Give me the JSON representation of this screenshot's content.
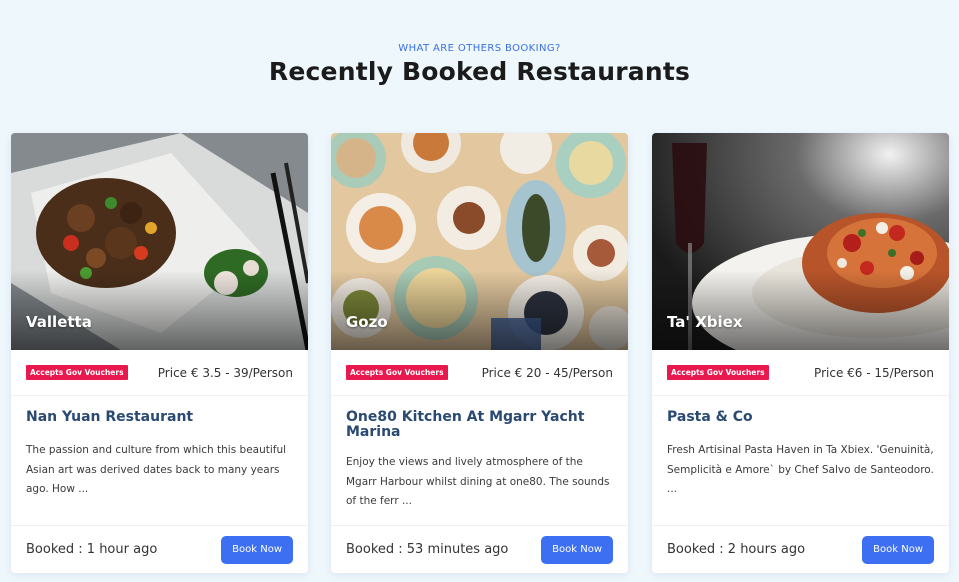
{
  "header": {
    "eyebrow": "WHAT ARE OTHERS BOOKING?",
    "title": "Recently Booked Restaurants"
  },
  "colors": {
    "accent": "#3d6ff2",
    "badge": "#e8194f",
    "restaurant_name": "#2a4a72",
    "background": "#eef7fc"
  },
  "cards": [
    {
      "city": "Valletta",
      "badge": "Accepts Gov Vouchers",
      "price": "Price € 3.5 - 39/Person",
      "name": "Nan Yuan Restaurant",
      "description": "The passion and culture from which this beautiful Asian art was derived dates back to many years ago. How ...",
      "booked": "Booked : 1 hour ago",
      "button": "Book Now"
    },
    {
      "city": "Gozo",
      "badge": "Accepts Gov Vouchers",
      "price": "Price € 20 - 45/Person",
      "name": "One80 Kitchen At Mgarr Yacht Marina",
      "description": "Enjoy the views and lively atmosphere of the Mgarr Harbour whilst dining at one80. The sounds of the ferr ...",
      "booked": "Booked : 53 minutes ago",
      "button": "Book Now"
    },
    {
      "city": "Ta' Xbiex",
      "badge": "Accepts Gov Vouchers",
      "price": "Price €6 - 15/Person",
      "name": "Pasta & Co",
      "description": "Fresh Artisinal Pasta Haven in Ta Xbiex. 'Genuinità, Semplicità e Amore` by Chef Salvo de Santeodoro. ...",
      "booked": "Booked : 2 hours ago",
      "button": "Book Now"
    }
  ]
}
